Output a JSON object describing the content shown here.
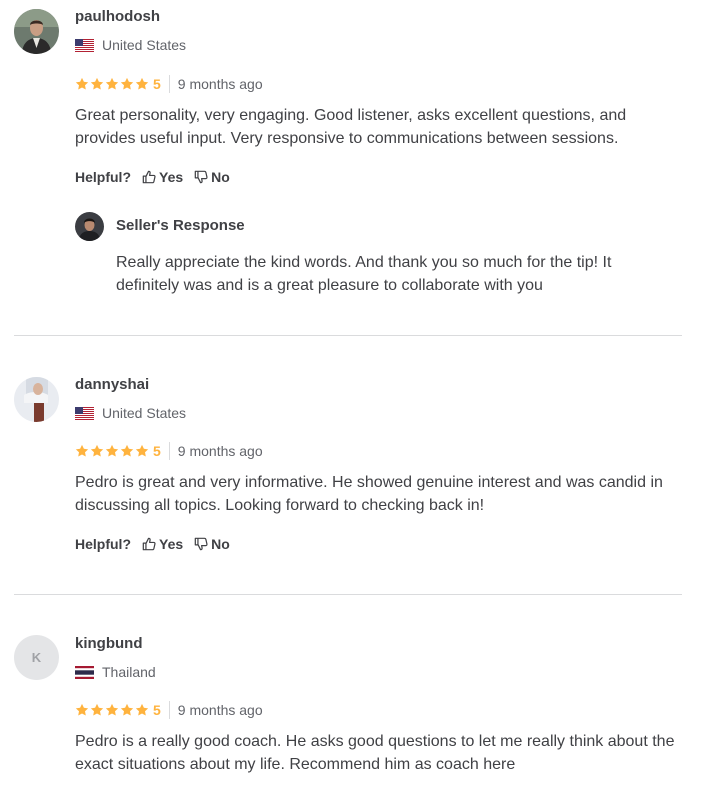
{
  "review_section": {
    "helpful_label": "Helpful?",
    "yes_label": "Yes",
    "no_label": "No",
    "star_color": "#ffb33e",
    "reviews": [
      {
        "username": "paulhodosh",
        "country": "United States",
        "flag_icon": "us-flag-icon",
        "rating": "5",
        "time": "9 months ago",
        "text": "Great personality, very engaging. Good listener, asks excellent questions, and provides useful input. Very responsive to communications between sessions.",
        "seller_response": {
          "title": "Seller's Response",
          "text": "Really appreciate the kind words. And thank you so much for the tip! It definitely was and is a great pleasure to collaborate with you"
        }
      },
      {
        "username": "dannyshai",
        "country": "United States",
        "flag_icon": "us-flag-icon",
        "rating": "5",
        "time": "9 months ago",
        "text": "Pedro is great and very informative. He showed genuine interest and was candid in discussing all topics. Looking forward to checking back in!"
      },
      {
        "username": "kingbund",
        "avatar_letter": "K",
        "country": "Thailand",
        "flag_icon": "thailand-flag-icon",
        "rating": "5",
        "time": "9 months ago",
        "text": "Pedro is a really good coach. He asks good questions to let me really think about the exact situations about my life. Recommend him as coach here"
      }
    ]
  }
}
